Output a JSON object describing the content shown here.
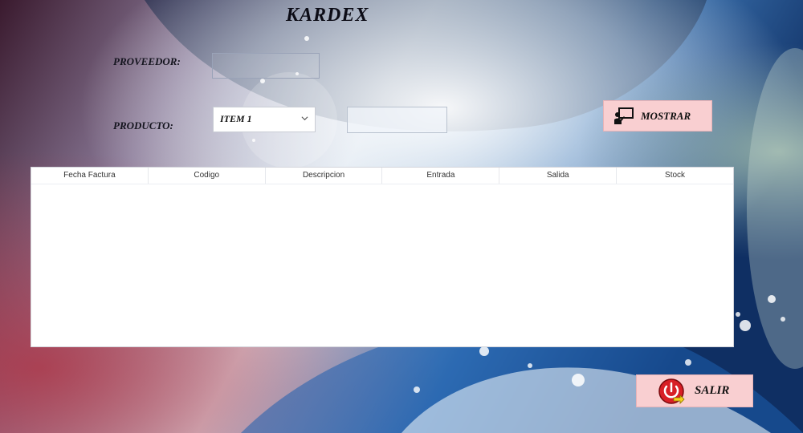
{
  "window": {
    "title": "KARDEX"
  },
  "form": {
    "proveedor_label": "PROVEEDOR:",
    "proveedor_value": "",
    "producto_label": "PRODUCTO:",
    "producto_selected": "ITEM 1",
    "producto_detail_value": ""
  },
  "buttons": {
    "mostrar": "MOSTRAR",
    "salir": "SALIR"
  },
  "table": {
    "columns": [
      "Fecha Factura",
      "Codigo",
      "Descripcion",
      "Entrada",
      "Salida",
      "Stock"
    ],
    "rows": []
  },
  "icons": {
    "mostrar": "presentation-board-icon",
    "salir": "power-exit-icon",
    "combo": "chevron-down-icon"
  }
}
